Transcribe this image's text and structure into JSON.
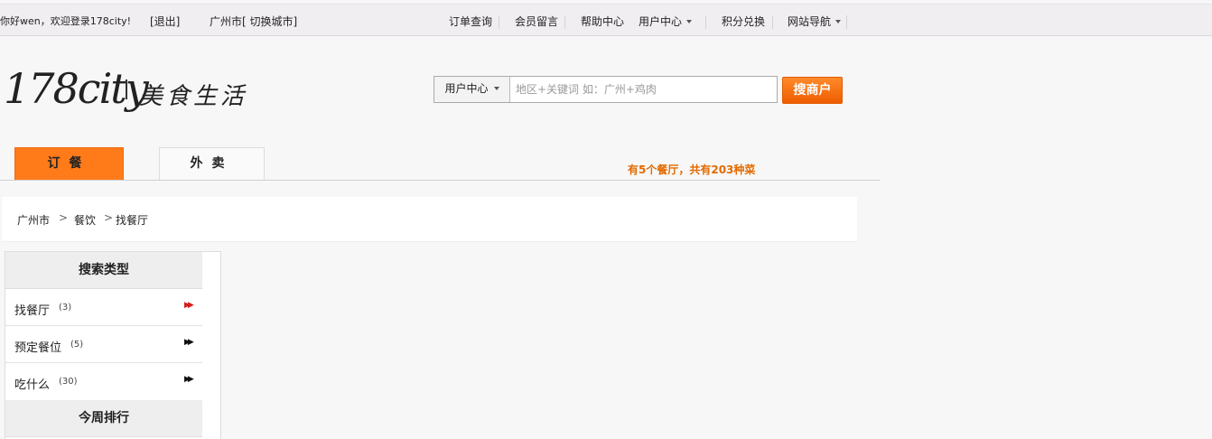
{
  "topbar": {
    "greeting": "你好wen，欢迎登录178city!",
    "logout": "[退出]",
    "city": "广州市[ 切换城市]",
    "links": {
      "order_query": "订单查询",
      "member_message": "会员留言",
      "help_center": "帮助中心",
      "user_center": "用户中心",
      "points_exchange": "积分兑换",
      "site_nav": "网站导航"
    }
  },
  "logo": {
    "main": "178city",
    "sub": "美食生活"
  },
  "search": {
    "type_label": "用户中心",
    "placeholder": "地区+关键词 如：广州+鸡肉",
    "button": "搜商户"
  },
  "tabs": {
    "order": "订餐",
    "takeout": "外卖"
  },
  "stats": "有5个餐厅，共有203种菜",
  "breadcrumb": {
    "items": [
      "广州市",
      "餐饮",
      "找餐厅"
    ],
    "separator": ">"
  },
  "sidebar": {
    "search_type_title": "搜索类型",
    "items": [
      {
        "label": "找餐厅",
        "count": "(3)",
        "active": true
      },
      {
        "label": "预定餐位",
        "count": "(5)",
        "active": false
      },
      {
        "label": "吃什么",
        "count": "(30)",
        "active": false
      }
    ],
    "ranking_title": "今周排行"
  },
  "colors": {
    "accent": "#ff7b1a",
    "stats_text": "#e36a00",
    "active_arrow": "#d61c1c"
  }
}
